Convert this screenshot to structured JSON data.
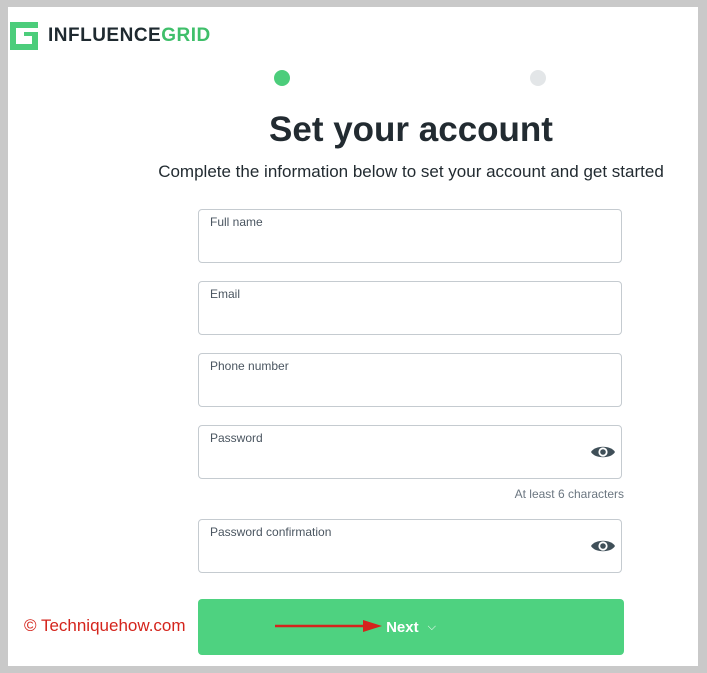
{
  "brand": {
    "name_part1": "INFLUENCE",
    "name_part2": "GRID",
    "color": "#3fbf6a",
    "icon": "influencegrid-logo-icon"
  },
  "steps": {
    "current": 1,
    "total": 2
  },
  "page": {
    "title": "Set your account",
    "subtitle": "Complete the information below to set your account and get started"
  },
  "form": {
    "full_name": {
      "label": "Full name",
      "value": ""
    },
    "email": {
      "label": "Email",
      "value": ""
    },
    "phone": {
      "label": "Phone number",
      "value": ""
    },
    "password": {
      "label": "Password",
      "value": "",
      "toggle_icon": "eye-icon",
      "hint": "At least 6 characters"
    },
    "password_confirmation": {
      "label": "Password confirmation",
      "value": "",
      "toggle_icon": "eye-icon"
    },
    "next_button": {
      "label": "Next",
      "chevron": "⌵",
      "color": "#4ed280"
    }
  },
  "watermark": {
    "text": "© Techniquehow.com",
    "color": "#d4241c"
  }
}
